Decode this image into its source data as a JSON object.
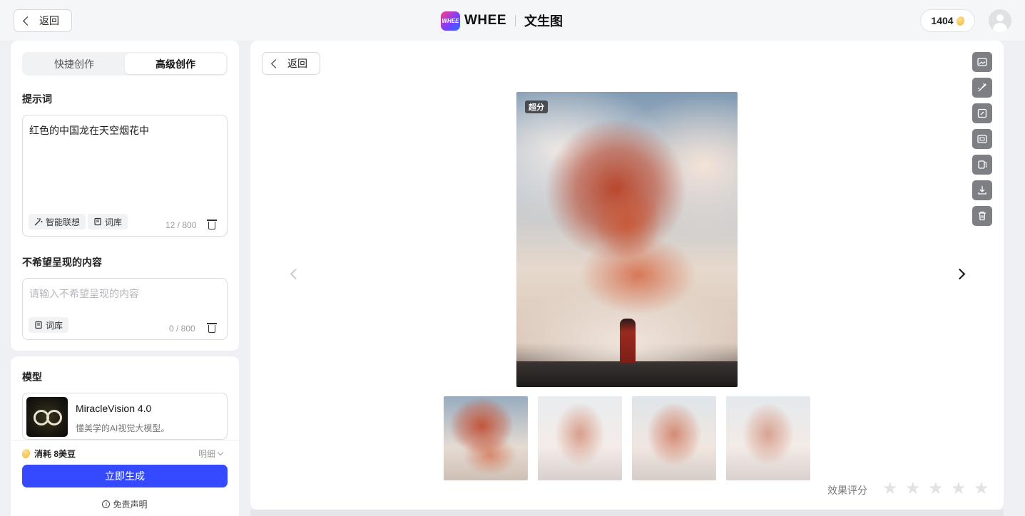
{
  "header": {
    "back_label": "返回",
    "logo_badge": "WHEE",
    "logo_text": "WHEE",
    "page_title": "文生图",
    "points": "1404"
  },
  "mode_tabs": [
    {
      "label": "快捷创作",
      "active": false
    },
    {
      "label": "高级创作",
      "active": true
    }
  ],
  "prompt": {
    "title": "提示词",
    "value": "红色的中国龙在天空烟花中",
    "smart_label": "智能联想",
    "library_label": "词库",
    "counter": "12 / 800"
  },
  "negative": {
    "title": "不希望呈现的内容",
    "placeholder": "请输入不希望呈现的内容",
    "library_label": "词库",
    "counter": "0 / 800"
  },
  "model": {
    "title": "模型",
    "name": "MiracleVision 4.0",
    "desc": "懂美学的AI视觉大模型。"
  },
  "footer": {
    "cost": "消耗 8美豆",
    "detail": "明细",
    "generate": "立即生成",
    "disclaimer": "免责声明"
  },
  "main": {
    "back_label": "返回",
    "tag": "超分",
    "rating_label": "效果评分",
    "stars": 5,
    "thumbnails": 4,
    "tools": [
      "image-edit-icon",
      "brush-icon",
      "edit-note-icon",
      "image-expand-icon",
      "copy-icon",
      "download-icon",
      "trash-icon"
    ]
  },
  "colors": {
    "accent": "#3549ff",
    "tool_bg": "#7d7f85"
  }
}
